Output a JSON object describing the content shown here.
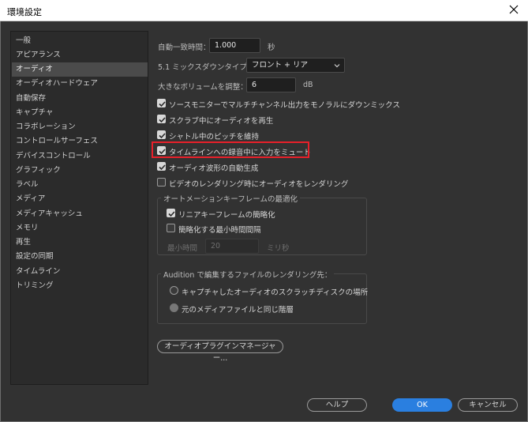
{
  "window": {
    "title": "環境設定"
  },
  "sidebar": {
    "items": [
      {
        "label": "一般"
      },
      {
        "label": "アピアランス"
      },
      {
        "label": "オーディオ",
        "active": true
      },
      {
        "label": "オーディオハードウェア"
      },
      {
        "label": "自動保存"
      },
      {
        "label": "キャプチャ"
      },
      {
        "label": "コラボレーション"
      },
      {
        "label": "コントロールサーフェス"
      },
      {
        "label": "デバイスコントロール"
      },
      {
        "label": "グラフィック"
      },
      {
        "label": "ラベル"
      },
      {
        "label": "メディア"
      },
      {
        "label": "メディアキャッシュ"
      },
      {
        "label": "メモリ"
      },
      {
        "label": "再生"
      },
      {
        "label": "設定の同期"
      },
      {
        "label": "タイムライン"
      },
      {
        "label": "トリミング"
      }
    ]
  },
  "audio": {
    "auto_match_label": "自動一致時間：",
    "auto_match_value": "1.000",
    "auto_match_unit": "秒",
    "downmix_label": "5.1 ミックスダウンタイプ：",
    "downmix_value": "フロント + リア",
    "volume_label": "大きなボリュームを調整：",
    "volume_value": "6",
    "volume_unit": "dB",
    "checkboxes": [
      {
        "label": "ソースモニターでマルチチャンネル出力をモノラルにダウンミックス",
        "checked": true
      },
      {
        "label": "スクラブ中にオーディオを再生",
        "checked": true
      },
      {
        "label": "シャトル中のピッチを維持",
        "checked": true
      },
      {
        "label": "タイムラインへの録音中に入力をミュート",
        "checked": true
      },
      {
        "label": "オーディオ波形の自動生成",
        "checked": true
      },
      {
        "label": "ビデオのレンダリング時にオーディオをレンダリング",
        "checked": false
      }
    ],
    "automation": {
      "title": "オートメーションキーフレームの最適化",
      "linear_label": "リニアキーフレームの簡略化",
      "linear_checked": true,
      "min_interval_label": "簡略化する最小時間間隔",
      "min_interval_checked": false,
      "min_time_label": "最小時間",
      "min_time_value": "20",
      "min_time_unit": "ミリ秒"
    },
    "audition": {
      "title": "Audition で編集するファイルのレンダリング先：",
      "option1": "キャプチャしたオーディオのスクラッチディスクの場所",
      "option2": "元のメディアファイルと同じ階層"
    },
    "plugin_manager_label": "オーディオプラグインマネージャー..."
  },
  "footer": {
    "help_label": "ヘルプ",
    "ok_label": "OK",
    "cancel_label": "キャンセル"
  },
  "colors": {
    "accent": "#2a7fe0",
    "highlight": "#e8202a"
  }
}
